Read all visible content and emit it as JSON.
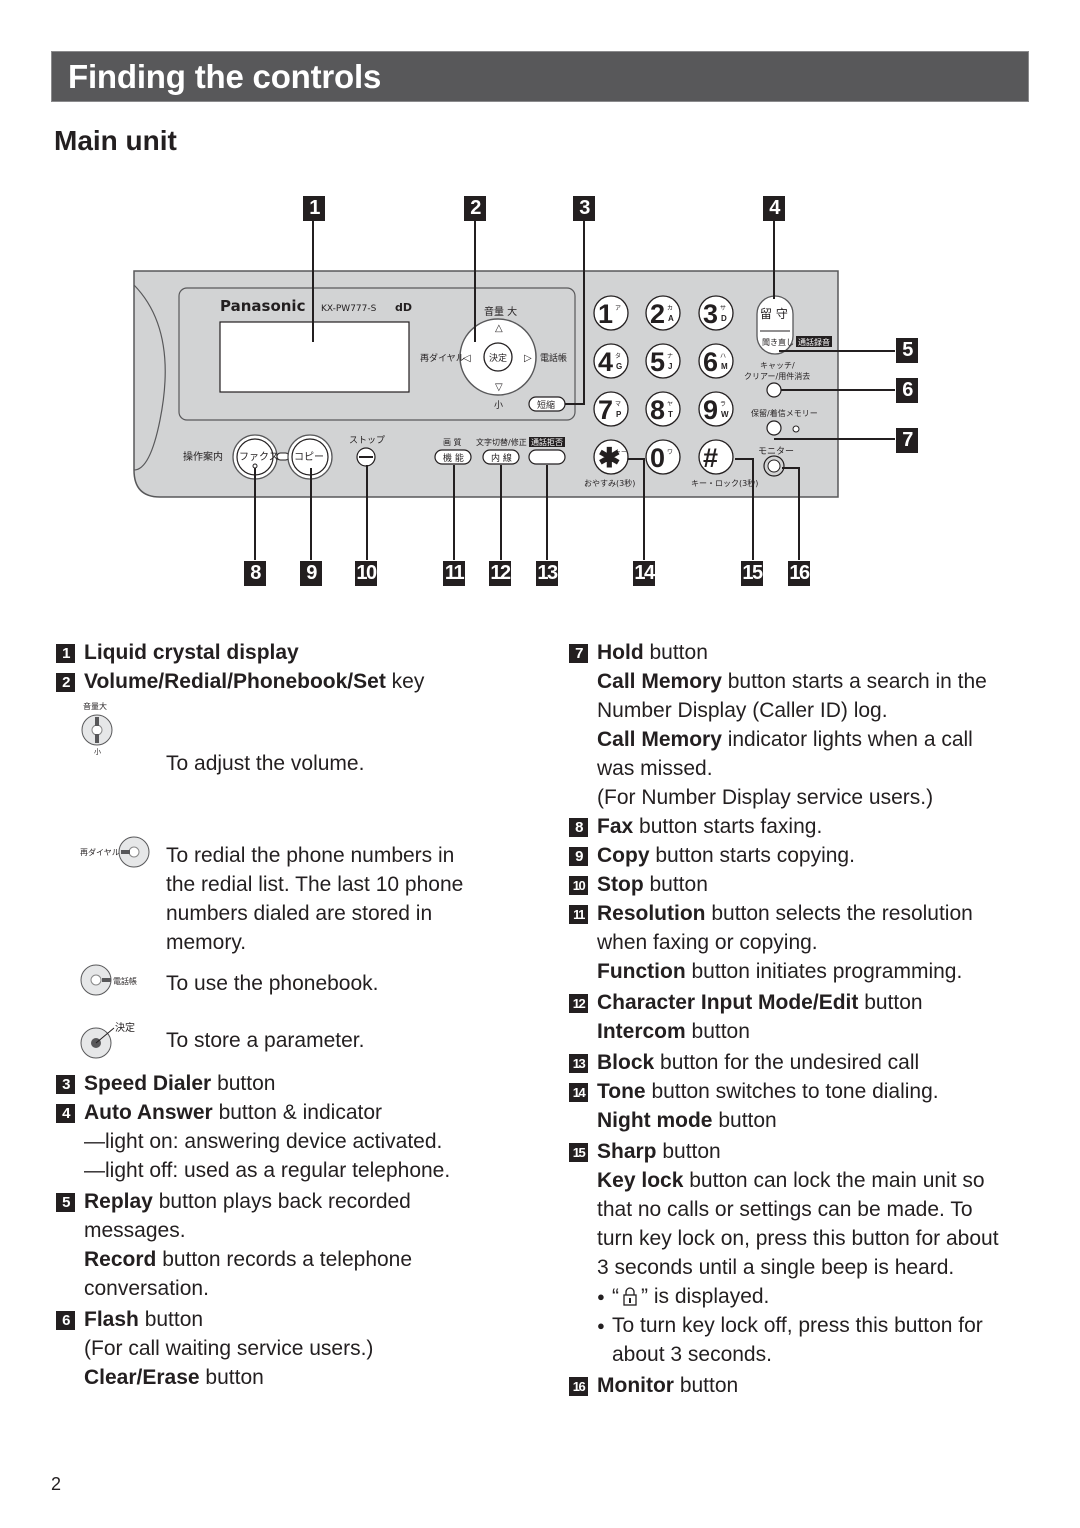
{
  "header": {
    "title": "Finding the controls"
  },
  "section": {
    "title": "Main unit"
  },
  "diagram": {
    "brand": "Panasonic",
    "model": "KX-PW777-S",
    "logo_mark": "dD",
    "callouts_top": [
      "1",
      "2",
      "3",
      "4"
    ],
    "callouts_right": [
      "5",
      "6",
      "7"
    ],
    "callouts_bottom": [
      "8",
      "9",
      "10",
      "11",
      "12",
      "13",
      "14",
      "15",
      "16"
    ],
    "labels": {
      "volume_up": "音量 大",
      "volume_down": "小",
      "redial": "再ダイヤル",
      "set": "決定",
      "phonebook": "電話帳",
      "speed_dial": "短縮",
      "guide": "操作案内",
      "fax": "ファクス",
      "copy": "コピー",
      "stop": "ストップ",
      "resolution": "画 質",
      "function": "機 能",
      "char_mode": "文字切替/修正",
      "intercom": "内 線",
      "block": "通話拒否",
      "auto_answer": "留 守",
      "replay": "聞き直し",
      "record": "通話録音",
      "flash": "キャッチ/\nクリアー/用件消去",
      "hold": "保留/着信メモリー",
      "monitor": "モニター",
      "night_mode": "おやすみ(3秒)",
      "key_lock": "キー・ロック(3秒)"
    },
    "keypad": [
      {
        "digit": "1",
        "kana": "ア",
        "letters": ""
      },
      {
        "digit": "2",
        "kana": "カ",
        "letters": "A"
      },
      {
        "digit": "3",
        "kana": "サ",
        "letters": "D"
      },
      {
        "digit": "4",
        "kana": "タ",
        "letters": "G"
      },
      {
        "digit": "5",
        "kana": "ナ",
        "letters": "J"
      },
      {
        "digit": "6",
        "kana": "ハ",
        "letters": "M"
      },
      {
        "digit": "7",
        "kana": "マ",
        "letters": "P"
      },
      {
        "digit": "8",
        "kana": "ヤ",
        "letters": "T"
      },
      {
        "digit": "9",
        "kana": "ラ",
        "letters": "W"
      },
      {
        "digit": "✱",
        "kana": "トーン",
        "letters": ""
      },
      {
        "digit": "0",
        "kana": "ワ",
        "letters": ""
      },
      {
        "digit": "#",
        "kana": "",
        "letters": ""
      }
    ]
  },
  "left_items": {
    "i1": {
      "num": "1",
      "bold": "Liquid crystal display",
      "rest": ""
    },
    "i2": {
      "num": "2",
      "bold": "Volume/Redial/Phonebook/Set",
      "rest": " key",
      "subs": [
        {
          "icon_label": "音量大",
          "text": "To adjust the volume."
        },
        {
          "icon_label": "再ダイヤル",
          "text": "To redial the phone numbers in the redial list. The last 10 phone numbers dialed are stored in memory."
        },
        {
          "icon_label": "電話帳",
          "text": "To use the phonebook."
        },
        {
          "icon_label": "決定",
          "text": "To store a parameter."
        }
      ],
      "redial_lines": [
        "To redial the phone numbers in",
        "the redial list. The last 10 phone",
        "numbers dialed are stored in",
        "memory."
      ]
    },
    "i3": {
      "num": "3",
      "bold": "Speed Dialer",
      "rest": " button"
    },
    "i4": {
      "num": "4",
      "bold": "Auto Answer",
      "rest": " button & indicator",
      "lines": [
        "—light on:  answering device activated.",
        "—light off:  used as a regular telephone."
      ]
    },
    "i5": {
      "num": "5",
      "bold": "Replay",
      "rest": " button plays back recorded",
      "line2": "messages.",
      "bold2": "Record",
      "rest2": " button records a telephone",
      "line4": "conversation."
    },
    "i6": {
      "num": "6",
      "bold": "Flash",
      "rest": " button",
      "line2": "(For call waiting service users.)",
      "bold2": "Clear/Erase",
      "rest2": " button"
    }
  },
  "right_items": {
    "i7": {
      "num": "7",
      "bold": "Hold",
      "rest": " button",
      "bold2": "Call Memory",
      "rest2": " button starts a search in the",
      "line3": "Number Display (Caller ID) log.",
      "bold3": "Call Memory",
      "rest3": " indicator lights when a call",
      "line5": "was missed.",
      "line6": "(For Number Display service users.)"
    },
    "i8": {
      "num": "8",
      "bold": "Fax",
      "rest": " button starts faxing."
    },
    "i9": {
      "num": "9",
      "bold": "Copy",
      "rest": " button starts copying."
    },
    "i10": {
      "num": "10",
      "bold": "Stop",
      "rest": " button"
    },
    "i11": {
      "num": "11",
      "bold": "Resolution",
      "rest": " button selects the resolution",
      "line2": "when faxing or copying.",
      "bold2": "Function",
      "rest2": " button initiates programming."
    },
    "i12": {
      "num": "12",
      "bold": "Character Input Mode/Edit",
      "rest": " button",
      "bold2": "Intercom",
      "rest2": " button"
    },
    "i13": {
      "num": "13",
      "bold": "Block",
      "rest": " button for the undesired call"
    },
    "i14": {
      "num": "14",
      "bold": "Tone",
      "rest": " button switches to tone dialing.",
      "bold2": "Night mode",
      "rest2": " button"
    },
    "i15": {
      "num": "15",
      "bold": "Sharp",
      "rest": " button",
      "bold2": "Key lock",
      "rest2": " button can lock the main unit so",
      "lines": [
        "that no calls or settings can be made. To",
        "turn key lock on, press this button for about",
        "3 seconds until a single beep is heard."
      ],
      "bullet1_pre": "“",
      "bullet1_icon": "lock-icon",
      "bullet1_post": "” is displayed.",
      "bullet2": "To turn key lock off, press this button for",
      "bullet2_cont": "about 3 seconds."
    },
    "i16": {
      "num": "16",
      "bold": "Monitor",
      "rest": " button"
    }
  },
  "footer": {
    "page_number": "2"
  }
}
